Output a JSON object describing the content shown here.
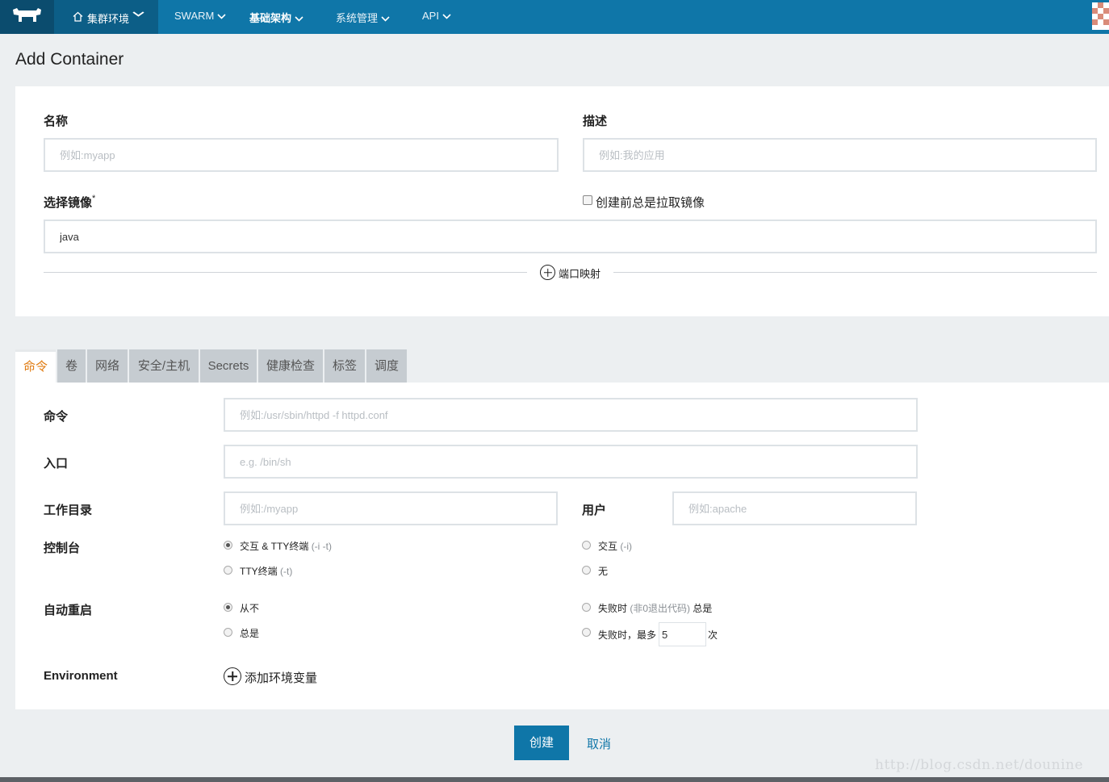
{
  "nav": {
    "env_label": "集群环境",
    "items": [
      "SWARM",
      "基础架构",
      "系统管理",
      "API"
    ]
  },
  "page_title": "Add Container",
  "form": {
    "name_label": "名称",
    "name_placeholder": "例如:myapp",
    "desc_label": "描述",
    "desc_placeholder": "例如:我的应用",
    "image_label": "选择镜像",
    "image_required": "*",
    "image_value": "java",
    "pull_label": "创建前总是拉取镜像",
    "port_map_label": "端口映射"
  },
  "tabs": [
    "命令",
    "卷",
    "网络",
    "安全/主机",
    "Secrets",
    "健康检查",
    "标签",
    "调度"
  ],
  "command": {
    "cmd_label": "命令",
    "cmd_placeholder": "例如:/usr/sbin/httpd -f httpd.conf",
    "entry_label": "入口",
    "entry_placeholder": "e.g. /bin/sh",
    "workdir_label": "工作目录",
    "workdir_placeholder": "例如:/myapp",
    "user_label": "用户",
    "user_placeholder": "例如:apache",
    "console_label": "控制台",
    "console_opts": {
      "it_main": "交互 & TTY终端",
      "it_hint": "(-i -t)",
      "i_main": "交互",
      "i_hint": "(-i)",
      "t_main": "TTY终端",
      "t_hint": "(-t)",
      "none": "无"
    },
    "restart_label": "自动重启",
    "restart_opts": {
      "never": "从不",
      "always": "总是",
      "fail_main": "失败时",
      "fail_hint": "(非0退出代码)",
      "fail_tail": "总是",
      "fail_max_prefix": "失败时，最多",
      "fail_max_value": "5",
      "fail_max_suffix": "次"
    },
    "env_label": "Environment",
    "add_env": "添加环境变量"
  },
  "actions": {
    "create": "创建",
    "cancel": "取消"
  },
  "watermark": "http://blog.csdn.net/dounine",
  "colors": {
    "nav": "#0f76a8",
    "nav_dark": "#0b4c6e",
    "active_tab": "#e07b10",
    "primary": "#0f76a8"
  }
}
